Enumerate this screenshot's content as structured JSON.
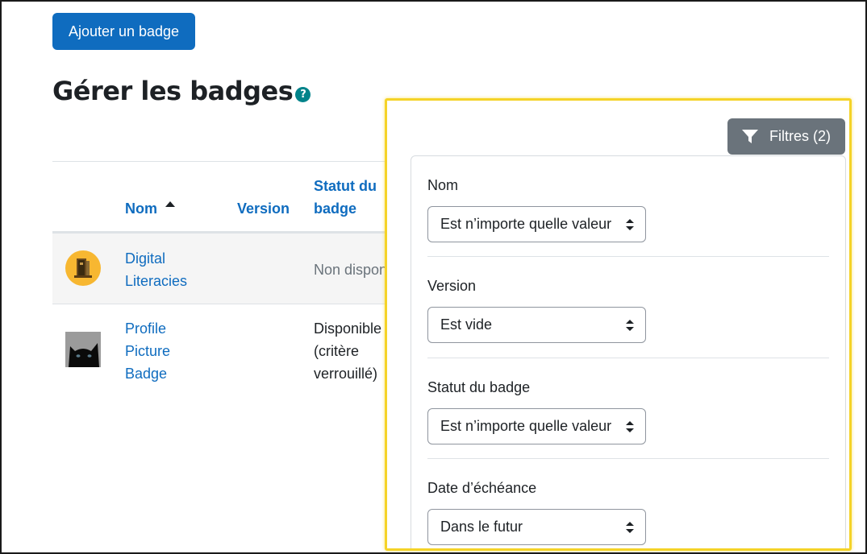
{
  "toolbar": {
    "add_badge_label": "Ajouter un badge"
  },
  "page": {
    "title": "Gérer les badges",
    "help_icon_glyph": "?"
  },
  "table": {
    "columns": {
      "name": "Nom",
      "version": "Version",
      "status_line1": "Statut du",
      "status_line2": "badge"
    },
    "sort": {
      "column": "Nom",
      "direction": "ascending"
    },
    "rows": [
      {
        "name_line1": "Digital",
        "name_line2": "Literacies",
        "status": "Non disponible",
        "image_icon": "book-badge-icon"
      },
      {
        "name_line1": "Profile",
        "name_line2": "Picture",
        "name_line3": "Badge",
        "status_line1": "Disponible",
        "status_line2": "(critère",
        "status_line3": "verrouillé)",
        "image_icon": "black-cat-badge-icon"
      }
    ]
  },
  "filters": {
    "button_label": "Filtres (2)",
    "button_icon": "funnel-icon",
    "items": [
      {
        "label": "Nom",
        "value": "Est n’importe quelle valeur"
      },
      {
        "label": "Version",
        "value": "Est vide"
      },
      {
        "label": "Statut du badge",
        "value": "Est n’importe quelle valeur"
      },
      {
        "label": "Date d’échéance",
        "value": "Dans le futur"
      }
    ]
  },
  "colors": {
    "primary": "#0f6cbf",
    "secondary_button": "#6a737b",
    "highlight_border": "#f5d327",
    "help_icon": "#00838a"
  }
}
